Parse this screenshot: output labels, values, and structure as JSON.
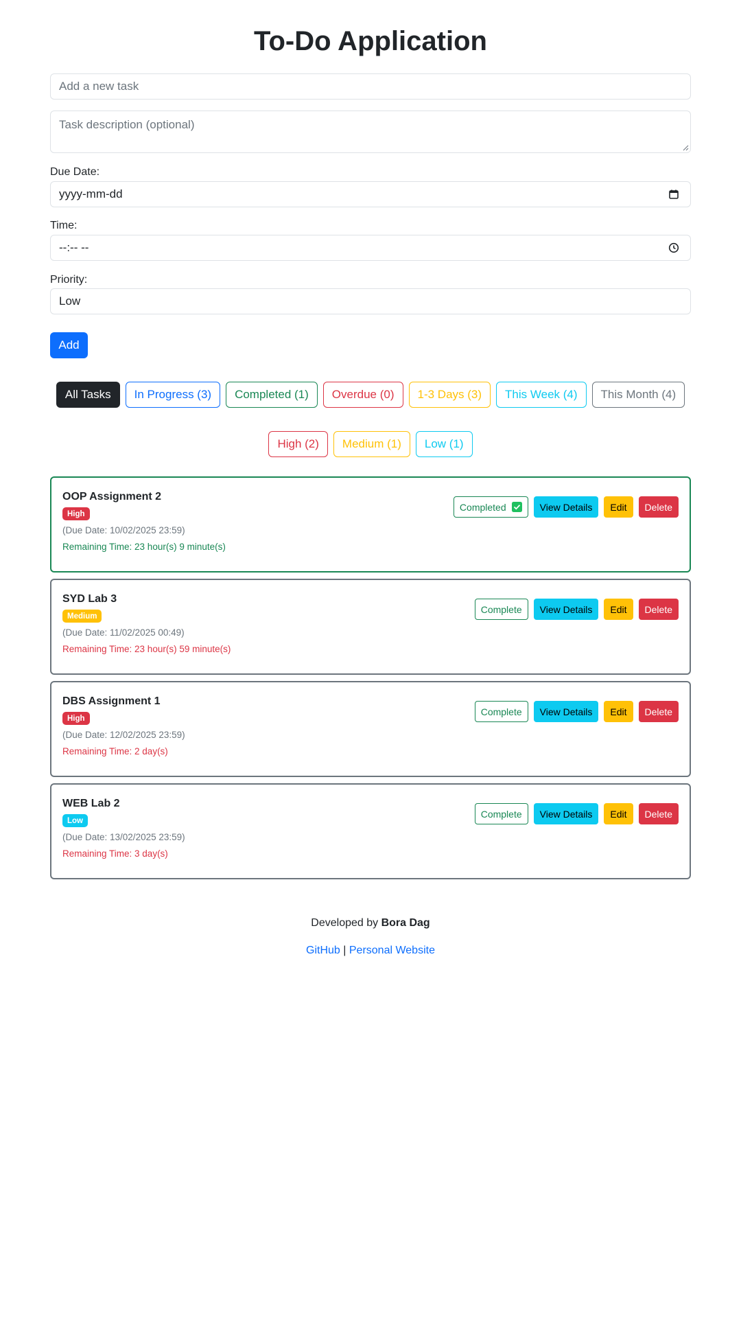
{
  "title": "To-Do Application",
  "form": {
    "task_placeholder": "Add a new task",
    "description_placeholder": "Task description (optional)",
    "due_date_label": "Due Date:",
    "due_date_value": "yyyy-mm-dd",
    "time_label": "Time:",
    "time_value": "--:-- --",
    "priority_label": "Priority:",
    "priority_value": "Low",
    "add_label": "Add"
  },
  "filters": [
    {
      "label": "All Tasks",
      "color": "#212529",
      "active": true
    },
    {
      "label": "In Progress (3)",
      "color": "#0d6efd"
    },
    {
      "label": "Completed (1)",
      "color": "#198754"
    },
    {
      "label": "Overdue (0)",
      "color": "#dc3545"
    },
    {
      "label": "1-3 Days (3)",
      "color": "#ffc107"
    },
    {
      "label": "This Week (4)",
      "color": "#0dcaf0"
    },
    {
      "label": "This Month (4)",
      "color": "#6c757d"
    }
  ],
  "priority_filters": [
    {
      "label": "High (2)",
      "color": "#dc3545"
    },
    {
      "label": "Medium (1)",
      "color": "#ffc107"
    },
    {
      "label": "Low (1)",
      "color": "#0dcaf0"
    }
  ],
  "tasks": [
    {
      "title": "OOP Assignment 2",
      "priority": "High",
      "priority_color": "#dc3545",
      "due": "(Due Date: 10/02/2025 23:59)",
      "remaining": "Remaining Time: 23 hour(s) 9 minute(s)",
      "remaining_color": "#198754",
      "status_label": "Completed",
      "completed": true
    },
    {
      "title": "SYD Lab 3",
      "priority": "Medium",
      "priority_color": "#ffc107",
      "due": "(Due Date: 11/02/2025 00:49)",
      "remaining": "Remaining Time: 23 hour(s) 59 minute(s)",
      "remaining_color": "#dc3545",
      "status_label": "Complete",
      "completed": false
    },
    {
      "title": "DBS Assignment 1",
      "priority": "High",
      "priority_color": "#dc3545",
      "due": "(Due Date: 12/02/2025 23:59)",
      "remaining": "Remaining Time: 2 day(s)",
      "remaining_color": "#dc3545",
      "status_label": "Complete",
      "completed": false
    },
    {
      "title": "WEB Lab 2",
      "priority": "Low",
      "priority_color": "#0dcaf0",
      "due": "(Due Date: 13/02/2025 23:59)",
      "remaining": "Remaining Time: 3 day(s)",
      "remaining_color": "#dc3545",
      "status_label": "Complete",
      "completed": false
    }
  ],
  "task_actions": {
    "view_label": "View Details",
    "edit_label": "Edit",
    "delete_label": "Delete"
  },
  "footer": {
    "developed_by": "Developed by",
    "author": "Bora Dag",
    "github": "GitHub",
    "separator": "|",
    "website": "Personal Website"
  },
  "colors": {
    "primary": "#0d6efd",
    "success": "#198754",
    "danger": "#dc3545",
    "warning": "#ffc107",
    "info": "#0dcaf0",
    "secondary": "#6c757d",
    "dark": "#212529"
  }
}
